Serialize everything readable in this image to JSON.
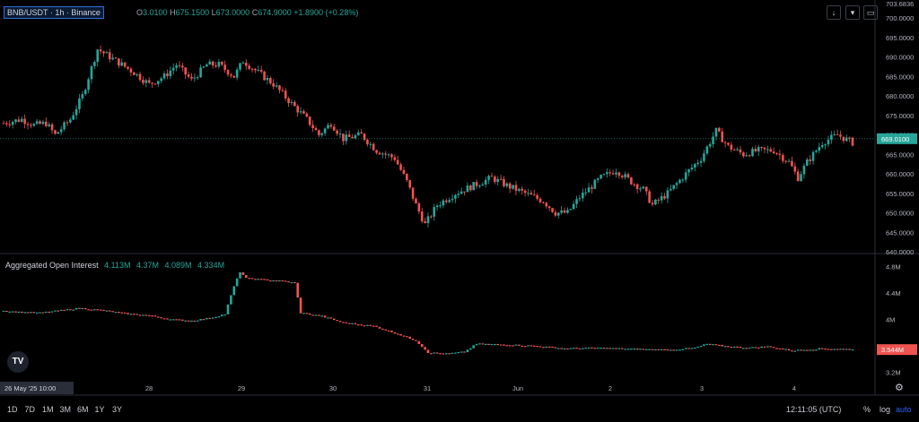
{
  "header": {
    "symbol": "BNB/USDT · 1h · Binance",
    "ohlc": [
      {
        "k": "O",
        "v": "3.0100"
      },
      {
        "k": "H",
        "v": "675.1500"
      },
      {
        "k": "L",
        "v": "673.0000"
      },
      {
        "k": "C",
        "v": "674.9000"
      },
      {
        "k": "",
        "v": "+1.8900 (+0.28%)"
      }
    ]
  },
  "toolbar": {
    "download_icon": "download-icon",
    "fullscreen_icon": "fullscreen-icon",
    "collapse_icon": "collapse-icon"
  },
  "indicator": {
    "name": "Aggregated Open Interest",
    "values": [
      "4.113M",
      "4.37M",
      "4.089M",
      "4.334M"
    ]
  },
  "bottom": {
    "ranges": [
      "1D",
      "7D",
      "1M",
      "3M",
      "6M",
      "1Y",
      "3Y"
    ],
    "clock": "12:11:05 (UTC)",
    "percent": "%",
    "log": "log",
    "auto": "auto"
  },
  "colors": {
    "up": "#26a69a",
    "down": "#ef5350",
    "price_tag": "#26a69a",
    "oi_tag": "#ef5350"
  },
  "chart_data": [
    {
      "type": "candlestick",
      "title": "BNB/USDT · 1h · Binance",
      "ylim": [
        640,
        703.6836
      ],
      "y_ticks": [
        "703.6836",
        "700.0000",
        "695.0000",
        "690.0000",
        "685.0000",
        "680.0000",
        "675.0000",
        "670.0000",
        "665.0000",
        "660.0000",
        "655.0000",
        "650.0000",
        "645.0000",
        "640.0000"
      ],
      "current_price_label": "669.0100",
      "x_tick_labels": [
        "26 May '25  10:00",
        "28",
        "29",
        "30",
        "31",
        "Jun",
        "2",
        "3",
        "4"
      ],
      "close_path": [
        [
          0,
          673
        ],
        [
          6,
          674
        ],
        [
          10,
          672.5
        ],
        [
          14,
          673
        ],
        [
          17,
          670
        ],
        [
          22,
          674
        ],
        [
          26,
          680
        ],
        [
          31,
          692
        ],
        [
          37,
          689
        ],
        [
          43,
          686
        ],
        [
          48,
          683
        ],
        [
          53,
          685
        ],
        [
          57,
          688
        ],
        [
          62,
          684
        ],
        [
          67,
          688
        ],
        [
          71,
          688
        ],
        [
          76,
          685
        ],
        [
          79,
          689
        ],
        [
          84,
          686
        ],
        [
          89,
          683
        ],
        [
          95,
          678
        ],
        [
          100,
          674
        ],
        [
          104,
          670
        ],
        [
          108,
          673
        ],
        [
          112,
          669
        ],
        [
          118,
          670
        ],
        [
          123,
          666
        ],
        [
          129,
          664
        ],
        [
          133,
          658
        ],
        [
          136,
          652
        ],
        [
          139,
          647
        ],
        [
          143,
          652
        ],
        [
          149,
          655
        ],
        [
          155,
          657
        ],
        [
          161,
          659
        ],
        [
          166,
          657
        ],
        [
          172,
          655
        ],
        [
          178,
          653
        ],
        [
          182,
          650
        ],
        [
          186,
          650
        ],
        [
          190,
          654
        ],
        [
          197,
          659
        ],
        [
          202,
          661
        ],
        [
          207,
          658
        ],
        [
          211,
          656
        ],
        [
          214,
          652
        ],
        [
          219,
          655
        ],
        [
          225,
          660
        ],
        [
          230,
          664
        ],
        [
          235,
          671
        ],
        [
          239,
          667
        ],
        [
          244,
          665
        ],
        [
          249,
          666
        ],
        [
          254,
          666
        ],
        [
          259,
          663
        ],
        [
          262,
          659
        ],
        [
          265,
          663
        ],
        [
          270,
          668
        ],
        [
          275,
          670
        ],
        [
          280,
          668
        ]
      ]
    },
    {
      "type": "bar",
      "title": "Aggregated Open Interest",
      "series_values": [
        "4.113M",
        "4.37M",
        "4.089M",
        "4.334M"
      ],
      "ylim": [
        3.1,
        4.9
      ],
      "y_ticks": [
        "4.8M",
        "4.4M",
        "4M",
        "3.2M"
      ],
      "current_value_label": "3.544M",
      "path": [
        [
          0,
          4.13
        ],
        [
          5,
          4.11
        ],
        [
          12,
          4.1
        ],
        [
          18,
          4.13
        ],
        [
          25,
          4.17
        ],
        [
          32,
          4.14
        ],
        [
          40,
          4.09
        ],
        [
          48,
          4.06
        ],
        [
          55,
          4.0
        ],
        [
          62,
          3.98
        ],
        [
          68,
          4.02
        ],
        [
          73,
          4.08
        ],
        [
          76,
          4.5
        ],
        [
          78,
          4.72
        ],
        [
          80,
          4.62
        ],
        [
          86,
          4.6
        ],
        [
          92,
          4.58
        ],
        [
          96,
          4.55
        ],
        [
          98,
          4.1
        ],
        [
          105,
          4.05
        ],
        [
          112,
          3.95
        ],
        [
          122,
          3.9
        ],
        [
          130,
          3.78
        ],
        [
          136,
          3.68
        ],
        [
          140,
          3.5
        ],
        [
          146,
          3.48
        ],
        [
          152,
          3.51
        ],
        [
          156,
          3.63
        ],
        [
          165,
          3.62
        ],
        [
          175,
          3.6
        ],
        [
          185,
          3.56
        ],
        [
          195,
          3.57
        ],
        [
          210,
          3.55
        ],
        [
          220,
          3.54
        ],
        [
          228,
          3.57
        ],
        [
          232,
          3.63
        ],
        [
          237,
          3.6
        ],
        [
          245,
          3.57
        ],
        [
          252,
          3.59
        ],
        [
          260,
          3.53
        ],
        [
          270,
          3.56
        ],
        [
          280,
          3.55
        ]
      ]
    }
  ]
}
